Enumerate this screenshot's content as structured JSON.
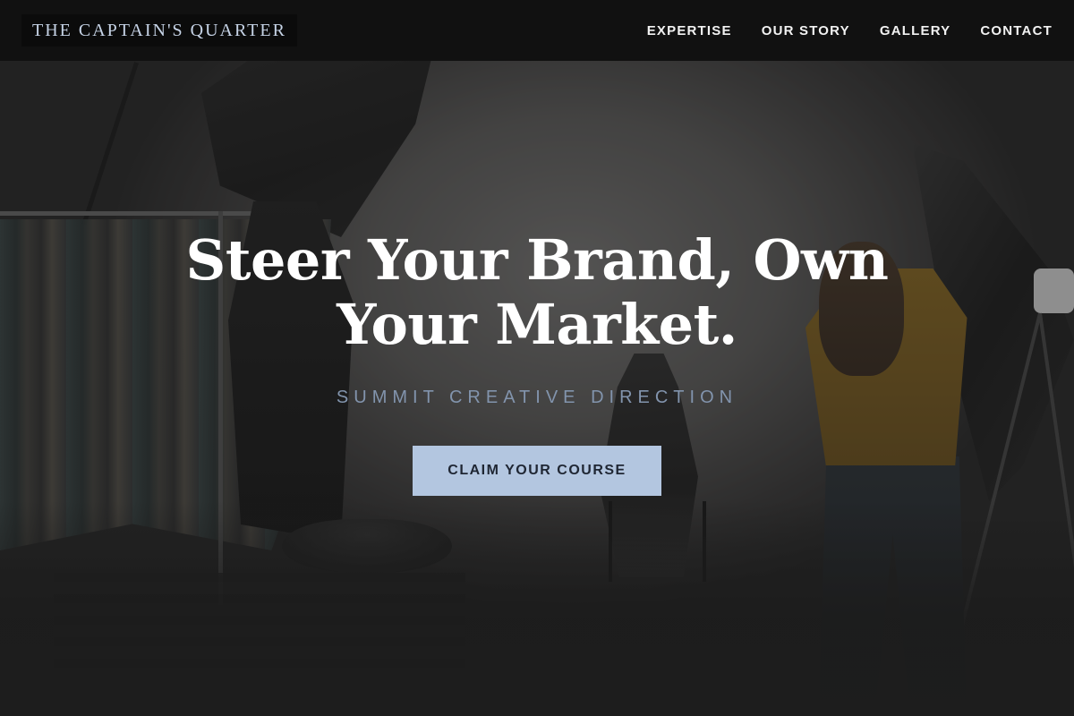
{
  "header": {
    "brand": "THE CAPTAIN'S QUARTER",
    "nav": [
      {
        "label": "EXPERTISE"
      },
      {
        "label": "OUR STORY"
      },
      {
        "label": "GALLERY"
      },
      {
        "label": "CONTACT"
      }
    ]
  },
  "hero": {
    "title": "Steer Your Brand, Own Your Market.",
    "subtitle": "SUMMIT CREATIVE DIRECTION",
    "cta_label": "CLAIM YOUR COURSE"
  },
  "colors": {
    "nav_background": "#111111",
    "brand_text": "#c6d3e6",
    "subtitle_text": "#8294ad",
    "cta_background": "#b3c6e0",
    "cta_text": "#1f2633"
  }
}
